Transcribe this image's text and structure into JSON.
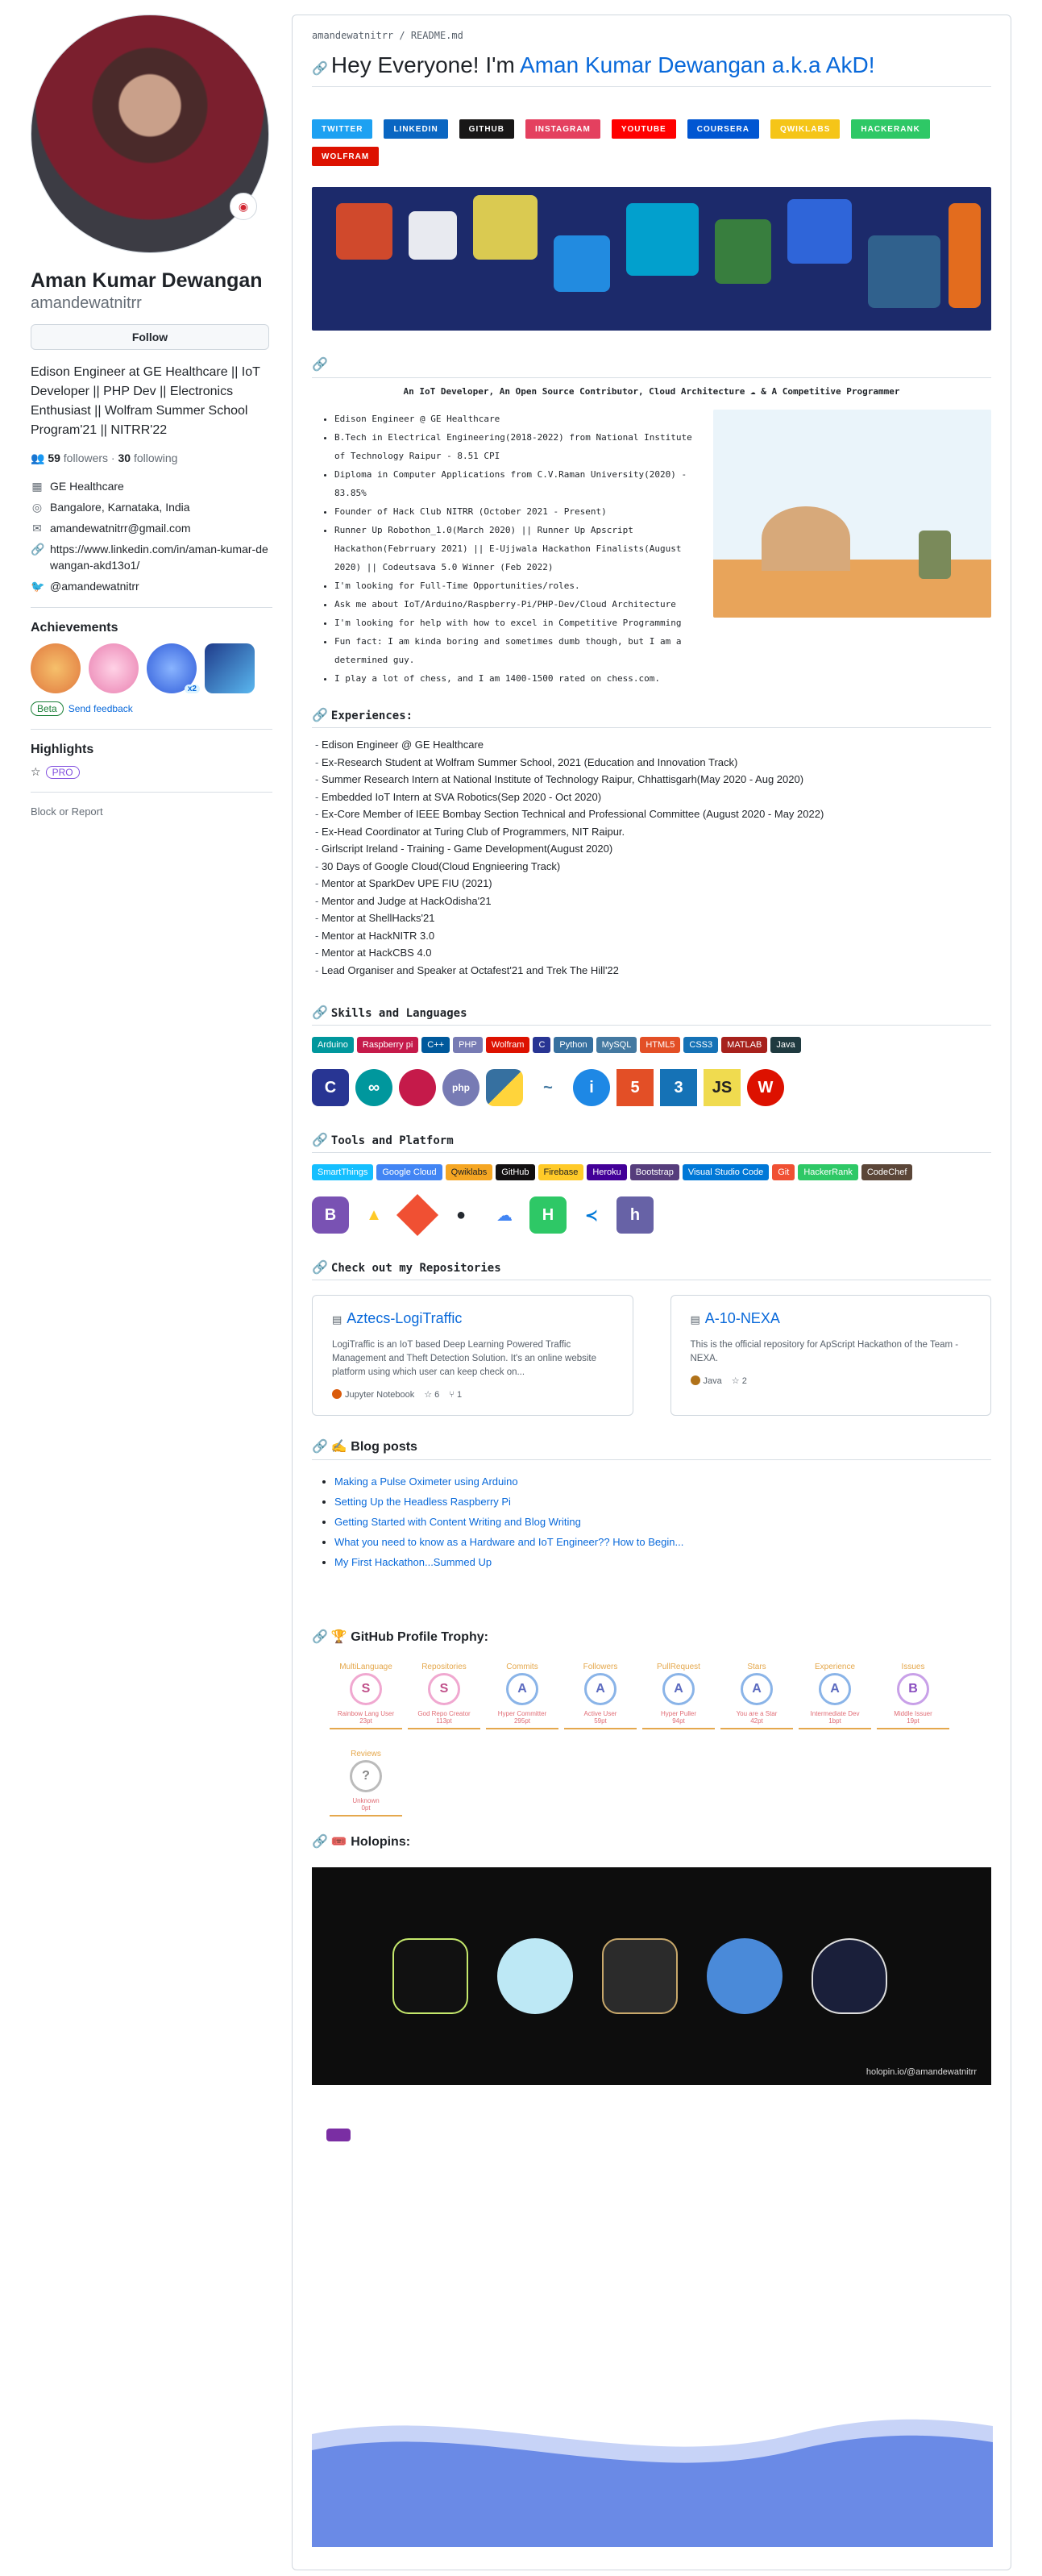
{
  "profile": {
    "fullname": "Aman Kumar Dewangan",
    "login": "amandewatnitrr",
    "follow_label": "Follow",
    "bio": "Edison Engineer at GE Healthcare || IoT Developer || PHP Dev || Electronics Enthusiast || Wolfram Summer School Program'21 || NITRR'22",
    "followers_count": "59",
    "followers_label": "followers",
    "following_count": "30",
    "following_label": "following",
    "company": "GE Healthcare",
    "location": "Bangalore, Karnataka, India",
    "email": "amandewatnitrr@gmail.com",
    "website": "https://www.linkedin.com/in/aman-kumar-dewangan-akd13o1/",
    "twitter": "@amandewatnitrr",
    "achievements_title": "Achievements",
    "beta_label": "Beta",
    "feedback_label": "Send feedback",
    "badge_x2": "x2",
    "highlights_title": "Highlights",
    "pro_label": "PRO",
    "block_label": "Block or Report"
  },
  "readme": {
    "breadcrumb": "amandewatnitrr / README.md",
    "greeting": "Hey Everyone! I'm ",
    "name_link": "Aman Kumar Dewangan a.k.a AkD!",
    "social_badges": [
      {
        "label": "TWITTER",
        "color": "#1da1f2"
      },
      {
        "label": "LINKEDIN",
        "color": "#0a66c2"
      },
      {
        "label": "GITHUB",
        "color": "#181717"
      },
      {
        "label": "INSTAGRAM",
        "color": "#e4405f"
      },
      {
        "label": "YOUTUBE",
        "color": "#ff0000"
      },
      {
        "label": "COURSERA",
        "color": "#0056d2"
      },
      {
        "label": "QWIKLABS",
        "color": "#f5c518"
      },
      {
        "label": "HACKERANK",
        "color": "#2ec866"
      },
      {
        "label": "WOLFRAM",
        "color": "#dd1100"
      }
    ],
    "tagline": "An IoT Developer, An Open Source Contributor, Cloud Architecture ☁ & A Competitive Programmer",
    "about": [
      "Edison Engineer @ GE Healthcare",
      "B.Tech in Electrical Engineering(2018-2022) from National Institute of Technology Raipur - 8.51 CPI",
      "Diploma in Computer Applications from C.V.Raman University(2020) - 83.85%",
      "Founder of Hack Club NITRR (October 2021 - Present)",
      "Runner Up Robothon_1.0(March 2020) || Runner Up Apscript Hackathon(Febrruary 2021) || E-Ujjwala Hackathon Finalists(August 2020) || Codeutsava 5.0 Winner (Feb 2022)",
      "I'm looking for Full-Time Opportunities/roles.",
      "Ask me about IoT/Arduino/Raspberry-Pi/PHP-Dev/Cloud Architecture",
      "I'm looking for help with how to excel in Competitive Programming",
      "Fun fact: I am kinda boring and sometimes dumb though, but I am a determined guy.",
      "I play a lot of chess, and I am 1400-1500 rated on chess.com."
    ],
    "experiences_title": "Experiences:",
    "experiences": [
      "Edison Engineer @ GE Healthcare",
      "Ex-Research Student at Wolfram Summer School, 2021 (Education and Innovation Track)",
      "Summer Research Intern at National Institute of Technology Raipur, Chhattisgarh(May 2020 - Aug 2020)",
      "Embedded IoT Intern at SVA Robotics(Sep 2020 - Oct 2020)",
      "Ex-Core Member of IEEE Bombay Section Technical and Professional Committee (August 2020 - May 2022)",
      "Ex-Head Coordinator at Turing Club of Programmers, NIT Raipur.",
      "Girlscript Ireland - Training - Game Development(August 2020)",
      "30 Days of Google Cloud(Cloud Engnieering Track)",
      "Mentor at SparkDev UPE FIU (2021)",
      "Mentor and Judge at HackOdisha'21",
      "Mentor at ShellHacks'21",
      "Mentor at HackNITR 3.0",
      "Mentor at HackCBS 4.0",
      "Lead Organiser and Speaker at Octafest'21 and Trek The Hill'22"
    ],
    "skills_title": "Skills and Languages",
    "skills": [
      {
        "label": "Arduino",
        "color": "#00979d"
      },
      {
        "label": "Raspberry pi",
        "color": "#c51a4a"
      },
      {
        "label": "C++",
        "color": "#00599c"
      },
      {
        "label": "PHP",
        "color": "#777bb4"
      },
      {
        "label": "Wolfram",
        "color": "#dd1100"
      },
      {
        "label": "C",
        "color": "#283593"
      },
      {
        "label": "Python",
        "color": "#3670a0"
      },
      {
        "label": "MySQL",
        "color": "#4479a1"
      },
      {
        "label": "HTML5",
        "color": "#e34f26"
      },
      {
        "label": "CSS3",
        "color": "#1572b6"
      },
      {
        "label": "MATLAB",
        "color": "#a7211c"
      },
      {
        "label": "Java",
        "color": "#1f3a40"
      }
    ],
    "tools_title": "Tools and Platform",
    "tools": [
      {
        "label": "SmartThings",
        "color": "#15bfff"
      },
      {
        "label": "Google Cloud",
        "color": "#4285f4"
      },
      {
        "label": "Qwiklabs",
        "color": "#f5a623"
      },
      {
        "label": "GitHub",
        "color": "#121011"
      },
      {
        "label": "Firebase",
        "color": "#ffca28"
      },
      {
        "label": "Heroku",
        "color": "#430098"
      },
      {
        "label": "Bootstrap",
        "color": "#563d7c"
      },
      {
        "label": "Visual Studio Code",
        "color": "#0078d7"
      },
      {
        "label": "Git",
        "color": "#f05033"
      },
      {
        "label": "HackerRank",
        "color": "#2ec866"
      },
      {
        "label": "CodeChef",
        "color": "#5b4638"
      }
    ],
    "repos_title": "Check out my Repositories",
    "repos": [
      {
        "name": "Aztecs-LogiTraffic",
        "desc": "LogiTraffic is an IoT based Deep Learning Powered Traffic Management and Theft Detection Solution. It's an online website platform using which user can keep check on...",
        "lang": "Jupyter Notebook",
        "lang_color": "#da5b0b",
        "stars": "6",
        "forks": "1"
      },
      {
        "name": "A-10-NEXA",
        "desc": "This is the official repository for ApScript Hackathon of the Team - NEXA.",
        "lang": "Java",
        "lang_color": "#b07219",
        "stars": "2",
        "forks": ""
      }
    ],
    "blog_title": "✍️ Blog posts",
    "blog": [
      "Making a Pulse Oximeter using Arduino",
      "Setting Up the Headless Raspberry Pi",
      "Getting Started with Content Writing and Blog Writing",
      "What you need to know as a Hardware and IoT Engineer?? How to Begin...",
      "My First Hackathon...Summed Up"
    ],
    "trophy_title": "🏆 GitHub Profile Trophy:",
    "trophies": [
      {
        "cat": "MultiLanguage",
        "rank": "S",
        "name": "Rainbow Lang User",
        "pt": "23pt"
      },
      {
        "cat": "Repositories",
        "rank": "S",
        "name": "God Repo Creator",
        "pt": "113pt"
      },
      {
        "cat": "Commits",
        "rank": "A",
        "name": "Hyper Committer",
        "pt": "295pt"
      },
      {
        "cat": "Followers",
        "rank": "A",
        "name": "Active User",
        "pt": "59pt"
      },
      {
        "cat": "PullRequest",
        "rank": "A",
        "name": "Hyper Puller",
        "pt": "94pt"
      },
      {
        "cat": "Stars",
        "rank": "A",
        "name": "You are a Star",
        "pt": "42pt"
      },
      {
        "cat": "Experience",
        "rank": "A",
        "name": "Intermediate Dev",
        "pt": "1bpt"
      },
      {
        "cat": "Issues",
        "rank": "B",
        "name": "Middle Issuer",
        "pt": "19pt"
      },
      {
        "cat": "Reviews",
        "rank": "?",
        "name": "Unknown",
        "pt": "0pt"
      }
    ],
    "holopins_title": "🎟️ Holopins:",
    "holopins_url": "holopin.io/@amandewatnitrr"
  }
}
